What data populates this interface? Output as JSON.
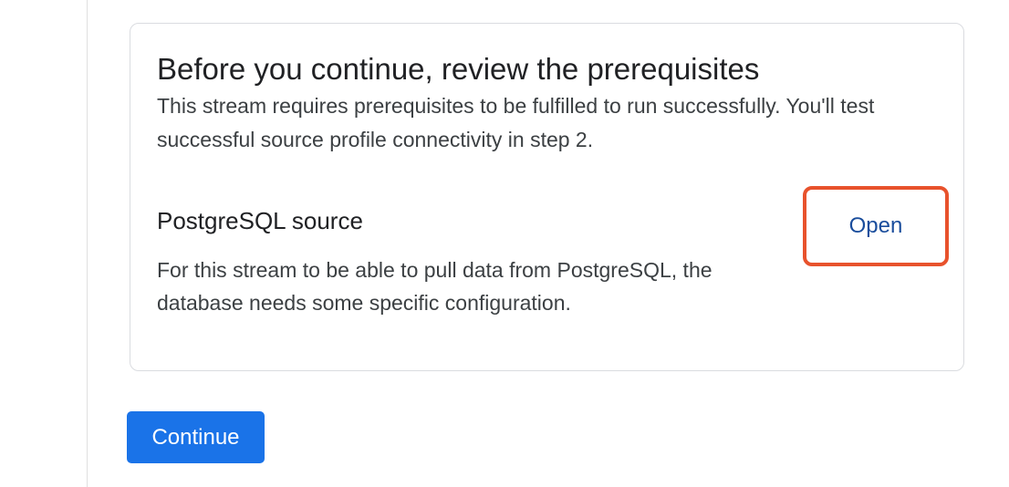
{
  "prerequisites": {
    "title": "Before you continue, review the prerequisites",
    "description": "This stream requires prerequisites to be fulfilled to run successfully. You'll test successful source profile connectivity in step 2.",
    "source": {
      "title": "PostgreSQL source",
      "description": "For this stream to be able to pull data from PostgreSQL, the database needs some specific configuration.",
      "open_label": "Open"
    }
  },
  "actions": {
    "continue_label": "Continue"
  },
  "colors": {
    "primary": "#1a73e8",
    "link": "#1a4d9c",
    "highlight": "#e8522c",
    "border": "#dadce0"
  }
}
